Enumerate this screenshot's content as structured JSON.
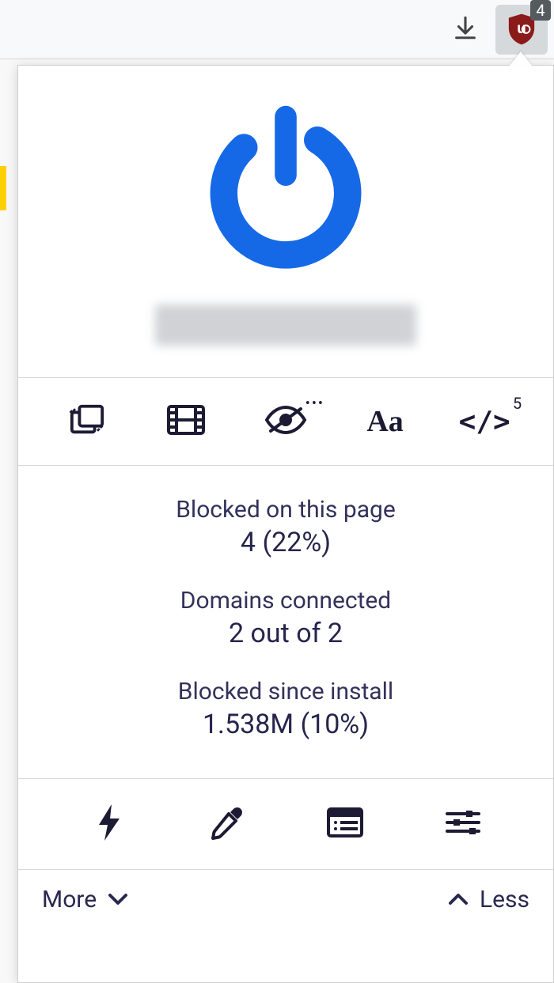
{
  "toolbar": {
    "extension_badge_count": "4"
  },
  "popup": {
    "toolrow": {
      "scripts_superscript": "5"
    },
    "stats": {
      "blocked_page_label": "Blocked on this page",
      "blocked_page_value": "4 (22%)",
      "domains_label": "Domains connected",
      "domains_value": "2 out of 2",
      "blocked_install_label": "Blocked since install",
      "blocked_install_value": "1.538M (10%)"
    },
    "footer": {
      "more_label": "More",
      "less_label": "Less"
    }
  },
  "colors": {
    "accent_blue": "#1669e6",
    "icon_ink": "#1d1a33",
    "shield_red": "#a01f1f"
  }
}
